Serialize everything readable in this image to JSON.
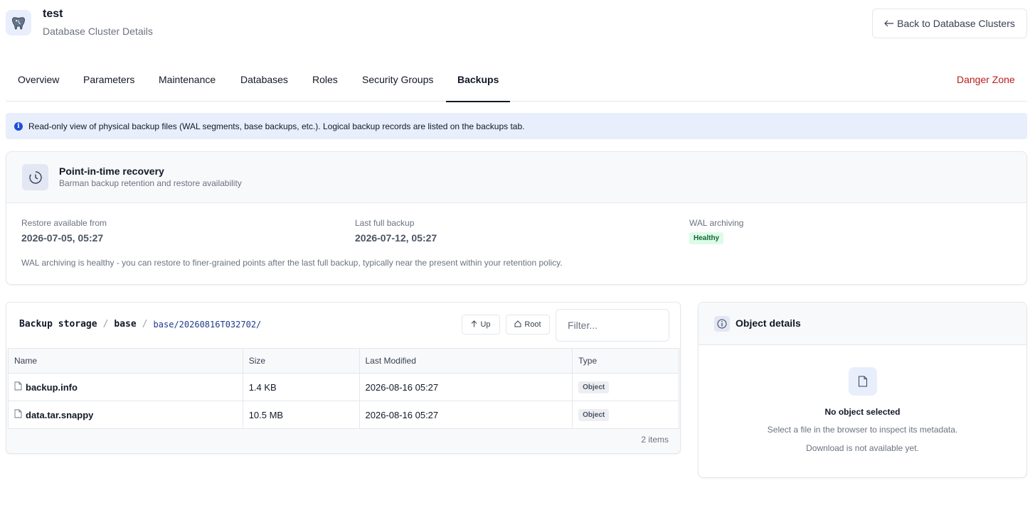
{
  "header": {
    "title": "test",
    "subtitle": "Database Cluster Details",
    "back_label": "Back to Database Clusters",
    "icon": "postgres-elephant-icon"
  },
  "tabs": [
    {
      "label": "Overview"
    },
    {
      "label": "Parameters"
    },
    {
      "label": "Maintenance"
    },
    {
      "label": "Databases"
    },
    {
      "label": "Roles"
    },
    {
      "label": "Security Groups"
    },
    {
      "label": "Backups",
      "active": true
    },
    {
      "label": "Danger Zone",
      "danger": true
    }
  ],
  "info_banner": {
    "text": "Read-only view of physical backup files (WAL segments, base backups, etc.). Logical backup records are listed on the backups tab."
  },
  "pitr": {
    "title": "Point-in-time recovery",
    "subtitle": "Barman backup retention and restore availability",
    "restore_from_label": "Restore available from",
    "restore_from_value": "2026-07-05, 05:27",
    "last_full_label": "Last full backup",
    "last_full_value": "2026-07-12, 05:27",
    "wal_label": "WAL archiving",
    "wal_status": "Healthy",
    "note": "WAL archiving is healthy - you can restore to finer-grained points after the last full backup, typically near the present within your retention policy."
  },
  "browser": {
    "crumb_root": "Backup storage",
    "crumb_sep": "/",
    "crumb_dir": "base",
    "crumb_path": "base/20260816T032702/",
    "up_label": "Up",
    "root_label": "Root",
    "filter_placeholder": "Filter...",
    "columns": [
      "Name",
      "Size",
      "Last Modified",
      "Type"
    ],
    "rows": [
      {
        "name": "backup.info",
        "size": "1.4 KB",
        "modified": "2026-08-16 05:27",
        "type": "Object"
      },
      {
        "name": "data.tar.snappy",
        "size": "10.5 MB",
        "modified": "2026-08-16 05:27",
        "type": "Object"
      }
    ],
    "count": "2 items"
  },
  "details": {
    "title": "Object details",
    "empty_title": "No object selected",
    "empty_line1": "Select a file in the browser to inspect its metadata.",
    "empty_line2": "Download is not available yet."
  },
  "colors": {
    "danger": "#b91c1c",
    "healthy_bg": "#dcfce7",
    "healthy_fg": "#166534",
    "info_bg": "#e8eefb"
  }
}
